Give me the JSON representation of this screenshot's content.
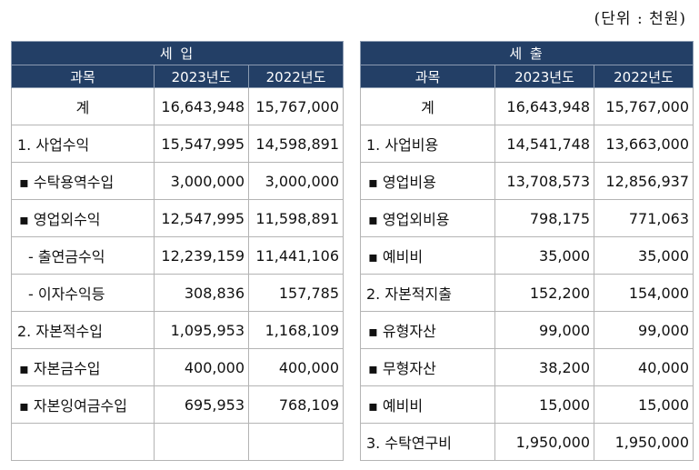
{
  "unit_note": "(단위 : 천원)",
  "income": {
    "section": "세      입",
    "headers": [
      "과목",
      "2023년도",
      "2022년도"
    ],
    "rows": [
      {
        "label": "계",
        "v2023": "16,643,948",
        "v2022": "15,767,000"
      },
      {
        "label": "1.  사업수익",
        "v2023": "15,547,995",
        "v2022": "14,598,891"
      },
      {
        "label": "▪ 수탁용역수입",
        "v2023": "3,000,000",
        "v2022": "3,000,000"
      },
      {
        "label": "▪ 영업외수익",
        "v2023": "12,547,995",
        "v2022": "11,598,891"
      },
      {
        "label": "-  출연금수익",
        "v2023": "12,239,159",
        "v2022": "11,441,106"
      },
      {
        "label": "-  이자수익등",
        "v2023": "308,836",
        "v2022": "157,785"
      },
      {
        "label": "2.  자본적수입",
        "v2023": "1,095,953",
        "v2022": "1,168,109"
      },
      {
        "label": "▪ 자본금수입",
        "v2023": "400,000",
        "v2022": "400,000"
      },
      {
        "label": "▪ 자본잉여금수입",
        "v2023": "695,953",
        "v2022": "768,109"
      },
      {
        "label": "",
        "v2023": "",
        "v2022": ""
      }
    ]
  },
  "expense": {
    "section": "세      출",
    "headers": [
      "과목",
      "2023년도",
      "2022년도"
    ],
    "rows": [
      {
        "label": "계",
        "v2023": "16,643,948",
        "v2022": "15,767,000"
      },
      {
        "label": "1.  사업비용",
        "v2023": "14,541,748",
        "v2022": "13,663,000"
      },
      {
        "label": "▪ 영업비용",
        "v2023": "13,708,573",
        "v2022": "12,856,937"
      },
      {
        "label": "▪ 영업외비용",
        "v2023": "798,175",
        "v2022": "771,063"
      },
      {
        "label": "▪ 예비비",
        "v2023": "35,000",
        "v2022": "35,000"
      },
      {
        "label": "2.  자본적지출",
        "v2023": "152,200",
        "v2022": "154,000"
      },
      {
        "label": "▪ 유형자산",
        "v2023": "99,000",
        "v2022": "99,000"
      },
      {
        "label": "▪ 무형자산",
        "v2023": "38,200",
        "v2022": "40,000"
      },
      {
        "label": "▪ 예비비",
        "v2023": "15,000",
        "v2022": "15,000"
      },
      {
        "label": "3.  수탁연구비",
        "v2023": "1,950,000",
        "v2022": "1,950,000"
      }
    ]
  }
}
